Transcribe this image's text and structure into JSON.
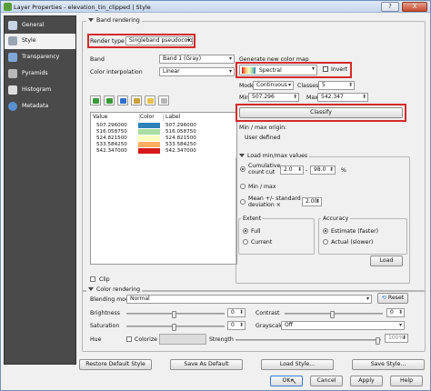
{
  "window": {
    "title": "Layer Properties - elevation_tin_clipped | Style",
    "help": "?",
    "close": "X"
  },
  "sidebar": {
    "items": [
      {
        "label": "General"
      },
      {
        "label": "Style"
      },
      {
        "label": "Transparency"
      },
      {
        "label": "Pyramids"
      },
      {
        "label": "Histogram"
      },
      {
        "label": "Metadata"
      }
    ]
  },
  "band_rendering": {
    "title": "Band rendering",
    "render_type_label": "Render type",
    "render_type_value": "Singleband pseudocolor",
    "band_label": "Band",
    "band_value": "Band 1 (Gray)",
    "interp_label": "Color interpolation",
    "interp_value": "Linear",
    "table_headers": [
      "Value",
      "Color",
      "Label"
    ],
    "rows": [
      {
        "value": "507.296000",
        "color": "#2b83ba",
        "label": "507.296000"
      },
      {
        "value": "516.058750",
        "color": "#abdda4",
        "label": "516.058750"
      },
      {
        "value": "524.821500",
        "color": "#ffffbf",
        "label": "524.821500"
      },
      {
        "value": "533.584250",
        "color": "#fdae61",
        "label": "533.584250"
      },
      {
        "value": "542.347000",
        "color": "#d7191c",
        "label": "542.347000"
      }
    ],
    "clip_label": "Clip"
  },
  "color_map": {
    "title": "Generate new color map",
    "ramp_name": "Spectral",
    "invert_label": "Invert",
    "mode_label": "Mode",
    "mode_value": "Continuous",
    "classes_label": "Classes",
    "classes_value": "5",
    "min_label": "Min",
    "min_value": "507.296",
    "max_label": "Max",
    "max_value": "542.347",
    "classify_label": "Classify",
    "origin_label": "Min / max origin:",
    "origin_value": "User defined"
  },
  "minmax": {
    "title": "Load min/max values",
    "cumulative_label": "Cumulative count cut",
    "cut_low": "2.0",
    "cut_high": "98.0",
    "percent": "%",
    "minmax_label": "Min / max",
    "meanstd_label": "Mean +/- standard deviation ×",
    "std_value": "2.00",
    "extent_title": "Extent",
    "extent_full": "Full",
    "extent_current": "Current",
    "accuracy_title": "Accuracy",
    "acc_estimate": "Estimate (faster)",
    "acc_actual": "Actual (slower)",
    "load_label": "Load"
  },
  "color_rendering": {
    "title": "Color rendering",
    "blending_label": "Blending mode",
    "blending_value": "Normal",
    "reset_label": "Reset",
    "brightness_label": "Brightness",
    "brightness_value": "0",
    "contrast_label": "Contrast",
    "contrast_value": "0",
    "saturation_label": "Saturation",
    "saturation_value": "0",
    "grayscale_label": "Grayscale",
    "grayscale_value": "Off",
    "hue_label": "Hue",
    "colorize_label": "Colorize",
    "strength_label": "Strength",
    "strength_value": "100%"
  },
  "footer": {
    "restore_label": "Restore Default Style",
    "save_default_label": "Save As Default",
    "load_style_label": "Load Style...",
    "save_style_label": "Save Style...",
    "ok_label": "OK",
    "cancel_label": "Cancel",
    "apply_label": "Apply",
    "help_label": "Help"
  }
}
